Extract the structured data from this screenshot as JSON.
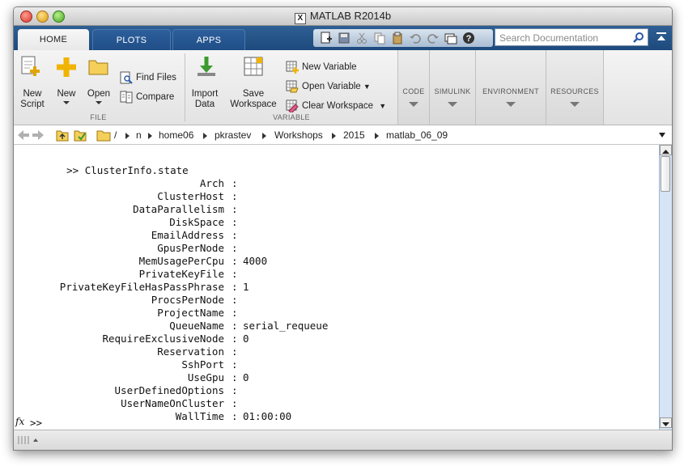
{
  "window": {
    "title": "MATLAB R2014b"
  },
  "tabs": [
    {
      "label": "HOME",
      "active": true
    },
    {
      "label": "PLOTS",
      "active": false
    },
    {
      "label": "APPS",
      "active": false
    }
  ],
  "search": {
    "placeholder": "Search Documentation"
  },
  "ribbon": {
    "file": {
      "title": "FILE",
      "new_script": {
        "line1": "New",
        "line2": "Script"
      },
      "new": "New",
      "open": "Open",
      "find_files": "Find Files",
      "compare": "Compare"
    },
    "variable": {
      "title": "VARIABLE",
      "import_data": {
        "line1": "Import",
        "line2": "Data"
      },
      "save_workspace": {
        "line1": "Save",
        "line2": "Workspace"
      },
      "new_variable": "New Variable",
      "open_variable": "Open Variable",
      "clear_workspace": "Clear Workspace"
    },
    "collapsed_groups": [
      "CODE",
      "SIMULINK",
      "ENVIRONMENT",
      "RESOURCES"
    ]
  },
  "address": {
    "crumbs": [
      "/",
      "n",
      "home06",
      "pkrastev",
      "Workshops",
      "2015",
      "matlab_06_09"
    ]
  },
  "command": {
    "prompt": ">>",
    "input": "ClusterInfo.state",
    "properties": [
      {
        "name": "Arch",
        "value": ""
      },
      {
        "name": "ClusterHost",
        "value": ""
      },
      {
        "name": "DataParallelism",
        "value": ""
      },
      {
        "name": "DiskSpace",
        "value": ""
      },
      {
        "name": "EmailAddress",
        "value": ""
      },
      {
        "name": "GpusPerNode",
        "value": ""
      },
      {
        "name": "MemUsagePerCpu",
        "value": "4000"
      },
      {
        "name": "PrivateKeyFile",
        "value": ""
      },
      {
        "name": "PrivateKeyFileHasPassPhrase",
        "value": "1"
      },
      {
        "name": "ProcsPerNode",
        "value": ""
      },
      {
        "name": "ProjectName",
        "value": ""
      },
      {
        "name": "QueueName",
        "value": "serial_requeue"
      },
      {
        "name": "RequireExclusiveNode",
        "value": "0"
      },
      {
        "name": "Reservation",
        "value": ""
      },
      {
        "name": "SshPort",
        "value": ""
      },
      {
        "name": "UseGpu",
        "value": "0"
      },
      {
        "name": "UserDefinedOptions",
        "value": ""
      },
      {
        "name": "UserNameOnCluster",
        "value": ""
      },
      {
        "name": "WallTime",
        "value": "01:00:00"
      }
    ],
    "fx_label": "fx",
    "final_prompt": ">>"
  },
  "colors": {
    "tabstrip": "#1d4a7d",
    "ribbon": "#e3e3e3",
    "scroll_track": "#d6e4f5"
  }
}
